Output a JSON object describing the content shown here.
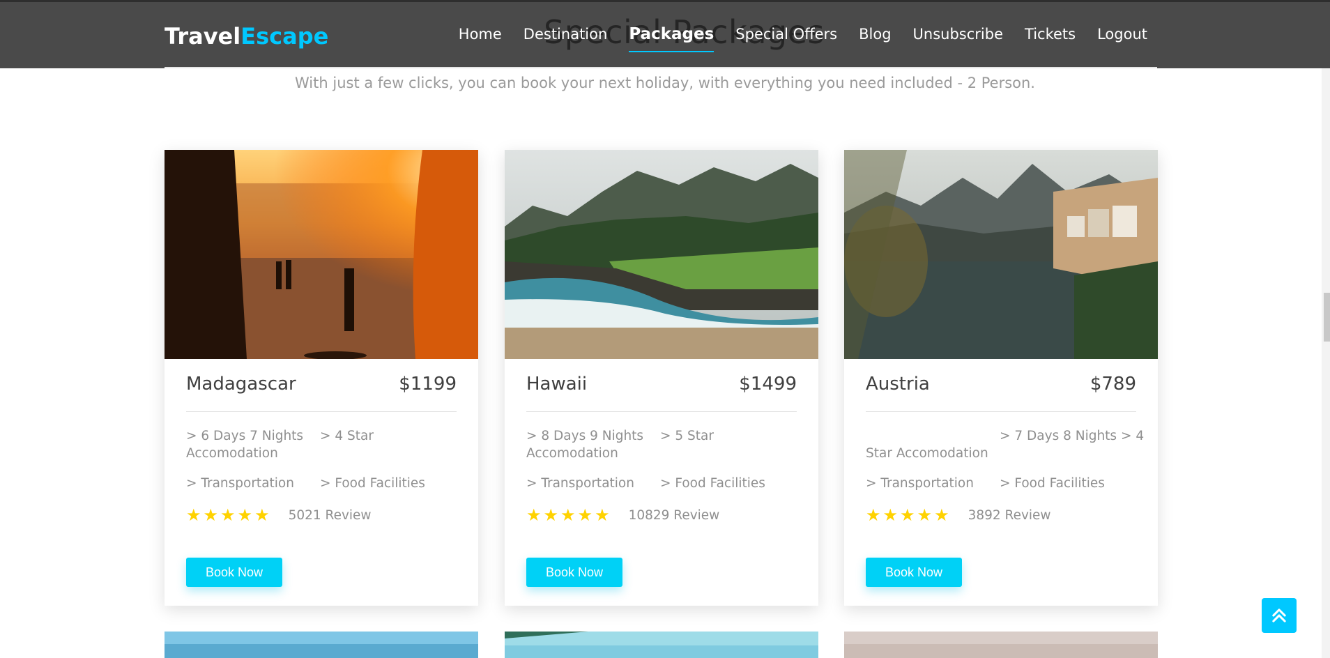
{
  "header": {
    "background_title": "Special Packages",
    "logo": {
      "part1": "Travel",
      "part2": "Escape"
    },
    "nav": [
      {
        "label": "Home"
      },
      {
        "label": "Destination"
      },
      {
        "label": "Packages",
        "active": true
      },
      {
        "label": "Special Offers"
      },
      {
        "label": "Blog"
      },
      {
        "label": "Unsubscribe"
      },
      {
        "label": "Tickets"
      },
      {
        "label": "Logout"
      }
    ]
  },
  "subtitle": "With just a few clicks, you can book your next holiday, with everything you need included - 2 Person.",
  "cards": [
    {
      "name": "Madagascar",
      "price": "$1199",
      "feat1": "> 6 Days 7 Nights",
      "feat1b": "> 4 Star",
      "feat1c": "Accomodation",
      "feat2": "> Transportation",
      "feat3": "> Food Facilities",
      "stars": "★★★★★",
      "reviews": "5021 Review",
      "button": "Book Now"
    },
    {
      "name": "Hawaii",
      "price": "$1499",
      "feat1": "> 8 Days 9 Nights",
      "feat1b": "> 5 Star",
      "feat1c": "Accomodation",
      "feat2": "> Transportation",
      "feat3": "> Food Facilities",
      "stars": "★★★★★",
      "reviews": "10829 Review",
      "button": "Book Now"
    },
    {
      "name": "Austria",
      "price": "$789",
      "feat1": "",
      "feat1b": "> 7 Days 8 Nights > 4",
      "feat1c": "Star Accomodation",
      "feat2": "> Transportation",
      "feat3": "> Food Facilities",
      "stars": "★★★★★",
      "reviews": "3892 Review",
      "button": "Book Now"
    }
  ],
  "colors": {
    "accent": "#00c8ff",
    "header_bg": "#4a4a4a",
    "star": "#ffd200"
  }
}
